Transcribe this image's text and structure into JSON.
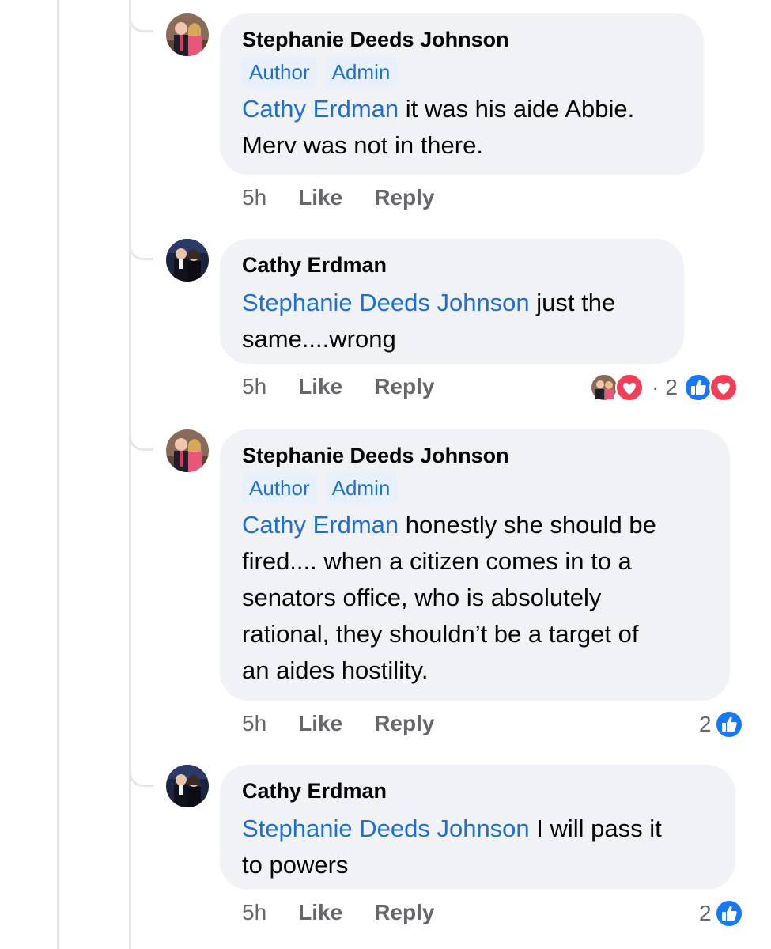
{
  "comments": [
    {
      "author": "Stephanie Deeds Johnson",
      "badges": [
        "Author",
        "Admin"
      ],
      "mention": "Cathy Erdman",
      "text_lines": [
        " it was his aide Abbie.",
        "Merv was not in there."
      ],
      "time": "5h",
      "like_label": "Like",
      "reply_label": "Reply"
    },
    {
      "author": "Cathy Erdman",
      "mention": "Stephanie Deeds Johnson",
      "text_lines": [
        " just the",
        "same....wrong"
      ],
      "time": "5h",
      "like_label": "Like",
      "reply_label": "Reply",
      "reactions": {
        "separator": "·",
        "count": "2",
        "icons": [
          "avatar-icon",
          "love-icon",
          "like-icon",
          "love-icon"
        ]
      }
    },
    {
      "author": "Stephanie Deeds Johnson",
      "badges": [
        "Author",
        "Admin"
      ],
      "mention": "Cathy Erdman",
      "text_lines": [
        " honestly she should be",
        "fired.... when a citizen comes in to a",
        "senators office, who  is absolutely",
        "rational, they shouldn’t be a target of",
        "an aides hostility."
      ],
      "time": "5h",
      "like_label": "Like",
      "reply_label": "Reply",
      "reactions": {
        "count": "2",
        "icons": [
          "like-icon"
        ]
      }
    },
    {
      "author": "Cathy Erdman",
      "mention": "Stephanie Deeds Johnson",
      "text_lines": [
        " I will pass it",
        "to powers"
      ],
      "time": "5h",
      "like_label": "Like",
      "reply_label": "Reply",
      "reactions": {
        "count": "2",
        "icons": [
          "like-icon"
        ]
      }
    }
  ],
  "colors": {
    "mention": "#1d6fd6",
    "bubble": "#f0f2f5",
    "like": "#1877f2",
    "love": "#f33e58"
  }
}
